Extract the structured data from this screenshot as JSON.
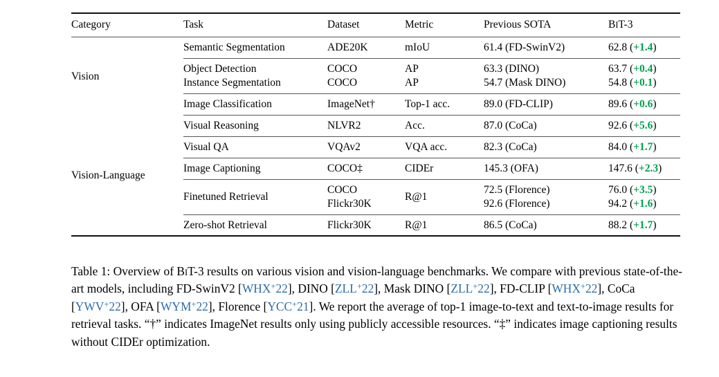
{
  "table": {
    "columns": [
      "Category",
      "Task",
      "Dataset",
      "Metric",
      "Previous SOTA",
      "BEiT-3"
    ],
    "beit_header": {
      "prefix": "B",
      "smallcap": "E",
      "mid": "i",
      "suffix": "T-3"
    },
    "accent_green": "#00A050",
    "cite_blue": "#2C6CA8",
    "groups": [
      {
        "category": "Vision",
        "blocks": [
          {
            "rows": [
              {
                "task": "Semantic Segmentation",
                "dataset": "ADE20K",
                "metric": "mIoU",
                "sota": "61.4 (FD-SwinV2)",
                "beit": "62.8",
                "delta": "+1.4"
              }
            ]
          },
          {
            "rows": [
              {
                "task": "Object Detection",
                "dataset": "COCO",
                "metric": "AP",
                "sota": "63.3 (DINO)",
                "beit": "63.7",
                "delta": "+0.4"
              },
              {
                "task": "Instance Segmentation",
                "dataset": "COCO",
                "metric": "AP",
                "sota": "54.7 (Mask DINO)",
                "beit": "54.8",
                "delta": "+0.1"
              }
            ]
          },
          {
            "rows": [
              {
                "task": "Image Classification",
                "dataset": "ImageNet†",
                "metric": "Top-1 acc.",
                "sota": "89.0 (FD-CLIP)",
                "beit": "89.6",
                "delta": "+0.6"
              }
            ]
          }
        ]
      },
      {
        "category": "Vision-Language",
        "blocks": [
          {
            "rows": [
              {
                "task": "Visual Reasoning",
                "dataset": "NLVR2",
                "metric": "Acc.",
                "sota": "87.0 (CoCa)",
                "beit": "92.6",
                "delta": "+5.6"
              }
            ]
          },
          {
            "rows": [
              {
                "task": "Visual QA",
                "dataset": "VQAv2",
                "metric": "VQA acc.",
                "sota": "82.3 (CoCa)",
                "beit": "84.0",
                "delta": "+1.7"
              }
            ]
          },
          {
            "rows": [
              {
                "task": "Image Captioning",
                "dataset": "COCO‡",
                "metric": "CIDEr",
                "sota": "145.3 (OFA)",
                "beit": "147.6",
                "delta": "+2.3"
              }
            ]
          },
          {
            "rows": [
              {
                "task": "Finetuned Retrieval",
                "dataset": "COCO",
                "metric": "R@1",
                "sota": "72.5 (Florence)",
                "beit": "76.0",
                "delta": "+3.5"
              },
              {
                "task": "",
                "dataset": "Flickr30K",
                "metric": "",
                "sota": "92.6 (Florence)",
                "beit": "94.2",
                "delta": "+1.6"
              }
            ]
          },
          {
            "rows": [
              {
                "task": "Zero-shot Retrieval",
                "dataset": "Flickr30K",
                "metric": "R@1",
                "sota": "86.5 (CoCa)",
                "beit": "88.2",
                "delta": "+1.7"
              }
            ]
          }
        ]
      }
    ]
  },
  "caption": {
    "label": "Table 1:",
    "p1": " Overview of B",
    "p1_sc": "E",
    "p1_i": "i",
    "p2": "T-3 results on various vision and vision-language benchmarks. We compare with previous state-of-the-art models, including FD-SwinV2 [",
    "c1": "WHX",
    "c1_num": "22",
    "p3": "], DINO [",
    "c2": "ZLL",
    "c2_num": "22",
    "p4": "], Mask DINO [",
    "c3": "ZLL",
    "c3_num": "22",
    "p5": "], FD-CLIP [",
    "c4": "WHX",
    "c4_num": "22",
    "p6": "], CoCa [",
    "c5": "YWV",
    "c5_num": "22",
    "p7": "], OFA [",
    "c6": "WYM",
    "c6_num": "22",
    "p8": "], Florence [",
    "c7": "YCC",
    "c7_num": "21",
    "p9": "]. We report the average of top-1 image-to-text and text-to-image results for retrieval tasks. “†” indicates ImageNet results only using publicly accessible resources. “‡” indicates image captioning results without CIDEr optimization."
  }
}
